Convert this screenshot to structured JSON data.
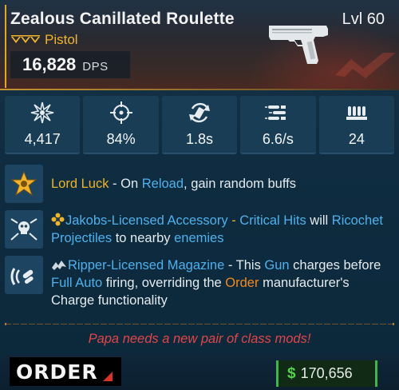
{
  "item": {
    "name": "Zealous Canillated Roulette",
    "level": "Lvl 60",
    "type": "Pistol",
    "dps_value": "16,828",
    "dps_unit": "DPS",
    "rarity_color": "#f2b52a"
  },
  "stats": [
    {
      "icon": "damage-burst-icon",
      "value": "4,417"
    },
    {
      "icon": "accuracy-crosshair-icon",
      "value": "84%"
    },
    {
      "icon": "reload-time-icon",
      "value": "1.8s"
    },
    {
      "icon": "fire-rate-icon",
      "value": "6.6/s"
    },
    {
      "icon": "magazine-size-icon",
      "value": "24"
    }
  ],
  "perks": {
    "p1": {
      "icon": "star-badge-icon",
      "title": "Lord Luck",
      "sep": " - On ",
      "kw1": "Reload",
      "rest": ", gain random buffs"
    },
    "p2": {
      "icon": "skull-arrows-icon",
      "mini_icon": "jakobs-flower-icon",
      "title": "Jakobs-Licensed Accessory",
      "sep": " - ",
      "kw1": "Critical Hits",
      "mid1": " will ",
      "kw2": "Ricochet Projectiles",
      "mid2": " to nearby ",
      "kw3": "enemies"
    },
    "p3": {
      "icon": "charge-magazine-icon",
      "mini_icon": "ripper-logo-icon",
      "title": "Ripper-Licensed Magazine",
      "sep": " - This ",
      "kw1": "Gun",
      "mid1": " charges before ",
      "kw2": "Full Auto",
      "mid2": " firing, overriding the ",
      "kw3": "Order",
      "rest": " manufacturer's Charge functionality"
    }
  },
  "flavor_text": "Papa needs a new pair of class mods!",
  "manufacturer": "ORDER",
  "price": {
    "currency": "$",
    "amount": "170,656"
  },
  "colors": {
    "legendary_orange": "#f08a24",
    "keyword_blue": "#4fb1ec",
    "title_yellow": "#f0b429",
    "flavor_red": "#e0464a",
    "money_green": "#58d24e"
  }
}
